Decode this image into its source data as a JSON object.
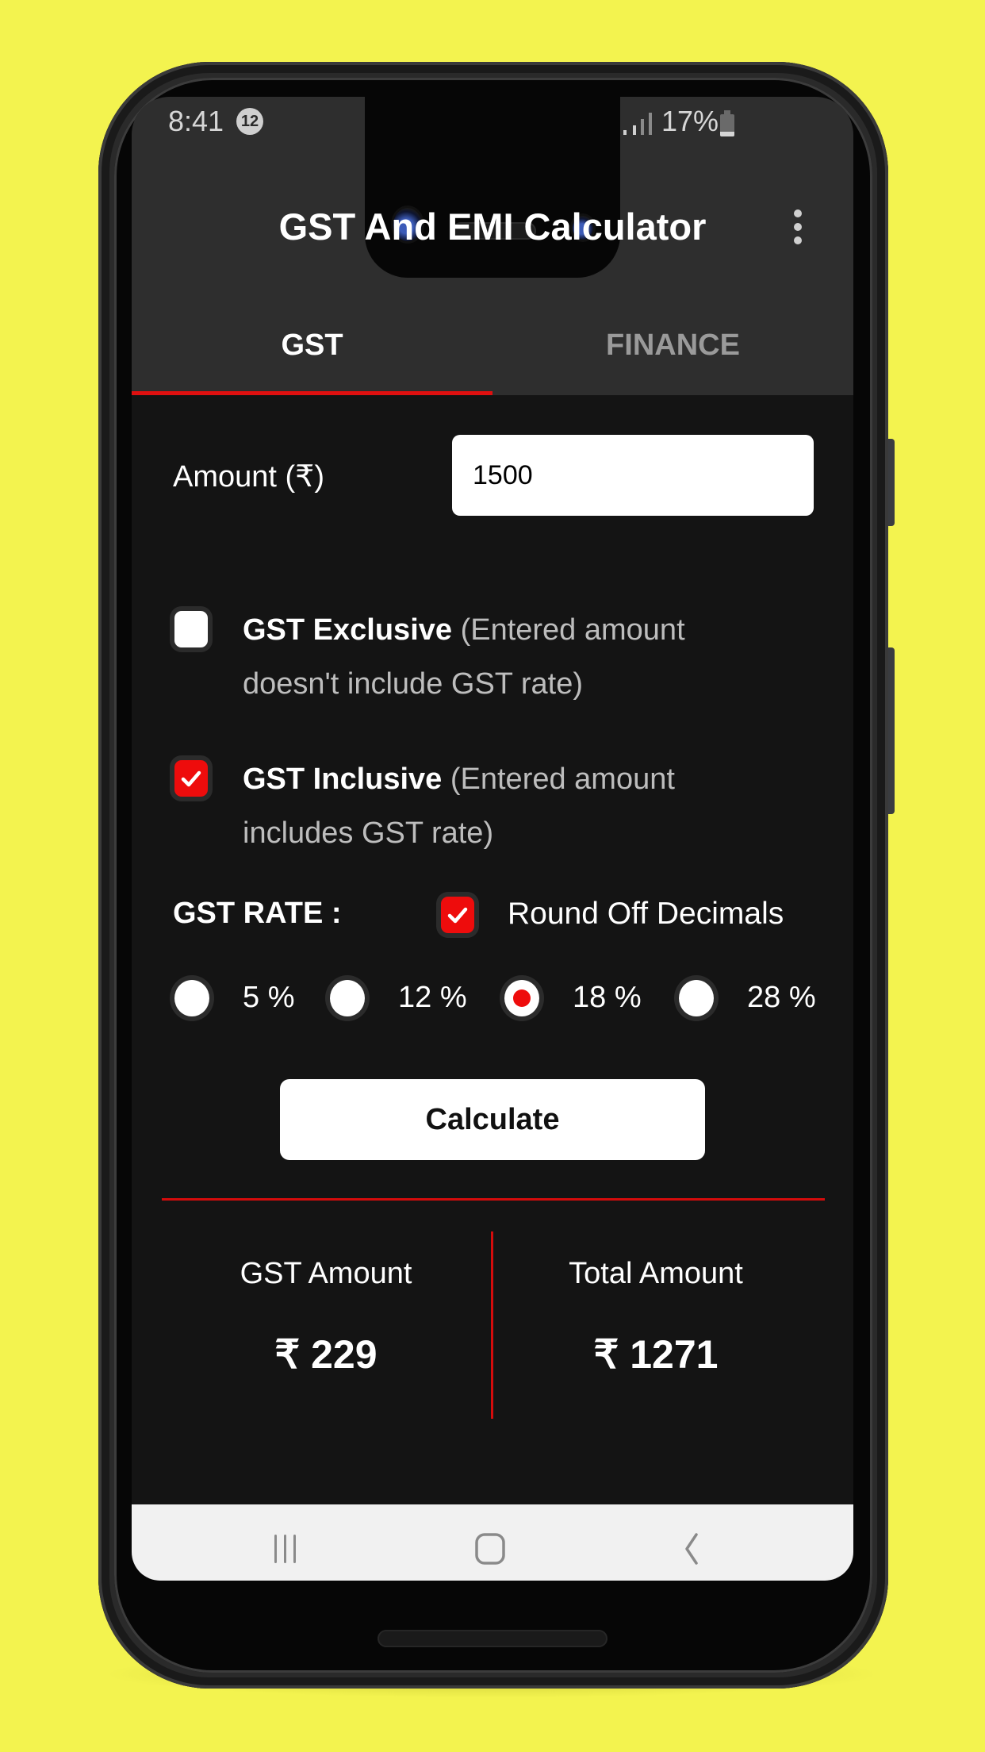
{
  "status_bar": {
    "time": "8:41",
    "notification_count": "12",
    "battery_percent": "17%"
  },
  "app_bar": {
    "title": "GST And EMI Calculator",
    "menu_icon": "more-vert-icon"
  },
  "tabs": [
    {
      "label": "GST",
      "selected": true
    },
    {
      "label": "FINANCE",
      "selected": false
    }
  ],
  "form": {
    "amount_label": "Amount (₹)",
    "amount_value": "1500",
    "options": [
      {
        "bold": "GST Exclusive",
        "desc": " (Entered amount doesn't include GST rate)",
        "checked": false
      },
      {
        "bold": "GST Inclusive",
        "desc": " (Entered amount includes GST rate)",
        "checked": true
      }
    ],
    "rate_label": "GST RATE :",
    "round_off_label": "Round Off Decimals",
    "round_off_checked": true,
    "rates": [
      {
        "label": "5 %",
        "selected": false
      },
      {
        "label": "12 %",
        "selected": false
      },
      {
        "label": "18 %",
        "selected": true
      },
      {
        "label": "28 %",
        "selected": false
      }
    ],
    "calculate_label": "Calculate"
  },
  "results": {
    "gst_amount_label": "GST Amount",
    "gst_amount_value": "₹ 229",
    "total_amount_label": "Total Amount",
    "total_amount_value": "₹ 1271"
  },
  "colors": {
    "accent": "#ee0c0c",
    "background": "#141414",
    "app_bar": "#2e2e2e",
    "page_background": "#f3f34f"
  }
}
